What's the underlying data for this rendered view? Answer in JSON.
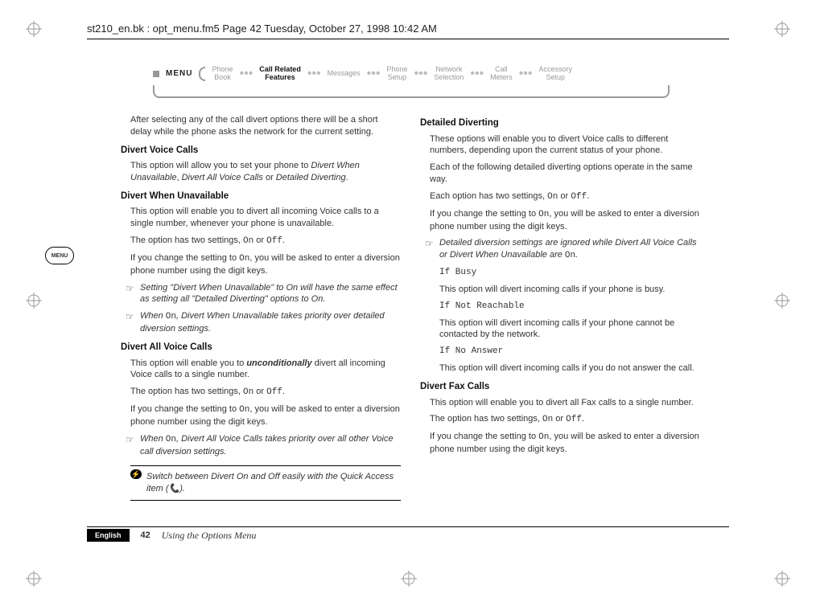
{
  "header": "st210_en.bk : opt_menu.fm5  Page 42  Tuesday, October 27, 1998  10:42 AM",
  "nav": {
    "menu": "MENU",
    "items": [
      {
        "l1": "Phone",
        "l2": "Book"
      },
      {
        "l1": "Call Related",
        "l2": "Features"
      },
      {
        "l1": "Messages",
        "l2": ""
      },
      {
        "l1": "Phone",
        "l2": "Setup"
      },
      {
        "l1": "Network",
        "l2": "Selection"
      },
      {
        "l1": "Call",
        "l2": "Meters"
      },
      {
        "l1": "Accessory",
        "l2": "Setup"
      }
    ]
  },
  "side_icon": "MENU",
  "left": {
    "intro": "After selecting any of the call divert options there will be a short delay while the phone asks the network for the current setting.",
    "h1": "Divert Voice Calls",
    "p1a": "This option will allow you to set your phone to ",
    "p1b": "Divert When Unavailable",
    "p1c": ", ",
    "p1d": "Divert All Voice Calls",
    "p1e": " or ",
    "p1f": "Detailed Diverting",
    "p1g": ".",
    "h2": "Divert When Unavailable",
    "p2": "This option will enable you to divert all incoming Voice calls to a single number, whenever your phone is unavailable.",
    "p3a": "The option has two settings, ",
    "on": "On",
    "or": " or ",
    "off": "Off",
    "dot": ".",
    "p4a": "If you change the setting to ",
    "p4b": ", you will be asked to enter a diversion phone number using the digit keys.",
    "n1": "Setting \"Divert When Unavailable\" to On will have the same effect as setting all \"Detailed Diverting\" options to On.",
    "n2a": "When ",
    "n2b": ", Divert When Unavailable takes priority over detailed diversion settings.",
    "h3": "Divert All Voice Calls",
    "p5a": "This option will enable you to ",
    "p5b": "unconditionally",
    "p5c": " divert all incoming Voice calls to a single number.",
    "p6a": "The option has two settings, ",
    "p7a": "If you change the setting to ",
    "p7b": ", you will be asked to enter a diversion phone number using the digit keys.",
    "n3a": "When ",
    "n3b": ", Divert All Voice Calls takes priority over all other Voice call diversion settings.",
    "quick": "Switch between Divert On and Off easily with the Quick Access item (📞)."
  },
  "right": {
    "h1": "Detailed Diverting",
    "p1": "These options will enable you to divert Voice calls to different numbers, depending upon the current status of your phone.",
    "p2": "Each of the following detailed diverting options operate in the same way.",
    "p3a": "Each option has two settings, ",
    "p4a": "If you change the setting to ",
    "p4b": ", you will be asked to enter a diversion phone number using the digit keys.",
    "n1a": "Detailed diversion settings are ignored while Divert All Voice Calls or Divert When Unavailable are ",
    "n1b": ".",
    "sub1": "If Busy",
    "sub1txt": "This option will divert incoming calls if your phone is busy.",
    "sub2": "If Not Reachable",
    "sub2txt": "This option will divert incoming calls if your phone cannot be contacted by the network.",
    "sub3": "If No Answer",
    "sub3txt": "This option will divert incoming calls if you do not answer the call.",
    "h2": "Divert Fax Calls",
    "p5": "This option will enable you to divert all Fax calls to a single number.",
    "p6a": "The option has two settings, ",
    "p7a": "If you change the setting to ",
    "p7b": ", you will be asked to enter a diversion phone number using the digit keys."
  },
  "footer": {
    "lang": "English",
    "page": "42",
    "text": "Using the Options Menu"
  }
}
